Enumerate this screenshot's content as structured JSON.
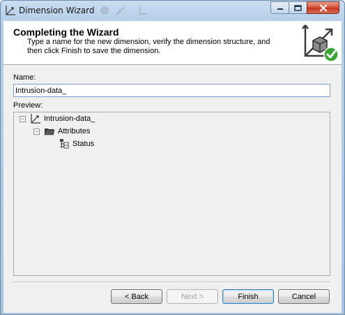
{
  "window": {
    "title": "Dimension Wizard"
  },
  "header": {
    "title": "Completing the Wizard",
    "description": "Type a name for the new dimension, verify the dimension structure, and then click Finish to save the dimension."
  },
  "name": {
    "label": "Name:",
    "value": "Intrusion-data_"
  },
  "preview": {
    "label": "Preview:",
    "root": {
      "label": "Intrusion-data_",
      "icon": "dimension-icon"
    },
    "folder": {
      "label": "Attributes",
      "icon": "folder-icon"
    },
    "attribute": {
      "label": "Status",
      "icon": "attribute-icon"
    }
  },
  "buttons": {
    "back": "< Back",
    "next": "Next >",
    "finish": "Finish",
    "cancel": "Cancel"
  },
  "colors": {
    "accent": "#3c7fb1",
    "check": "#3aa335",
    "close": "#c43a23"
  }
}
